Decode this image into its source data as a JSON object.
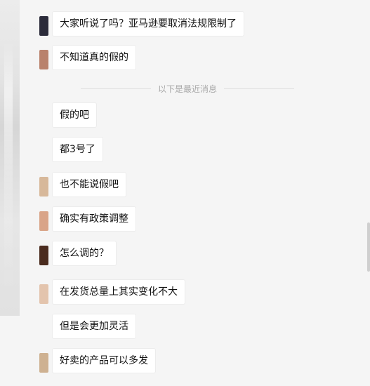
{
  "messages_before": [
    {
      "text": "大家听说了吗？亚马逊要取消法规限制了",
      "avatar_color": "#2b2b3a"
    },
    {
      "text": "不知道真的假的",
      "avatar_color": "#b9826c"
    }
  ],
  "divider_text": "以下是最近消息",
  "messages_after": [
    {
      "text": "假的吧",
      "avatar_color": "#f5f5f5"
    },
    {
      "text": "都3号了",
      "avatar_color": "#f5f5f5"
    },
    {
      "text": "也不能说假吧",
      "avatar_color": "#d7b89a"
    },
    {
      "text": "确实有政策调整",
      "avatar_color": "#d9a488"
    },
    {
      "text": "怎么调的？",
      "avatar_color": "#4a2b1e"
    },
    {
      "text": "在发货总量上其实变化不大",
      "avatar_color": "#e3c4ad"
    },
    {
      "text": "但是会更加灵活",
      "avatar_color": "#f5f5f5"
    },
    {
      "text": "好卖的产品可以多发",
      "avatar_color": "#ceb191"
    }
  ]
}
